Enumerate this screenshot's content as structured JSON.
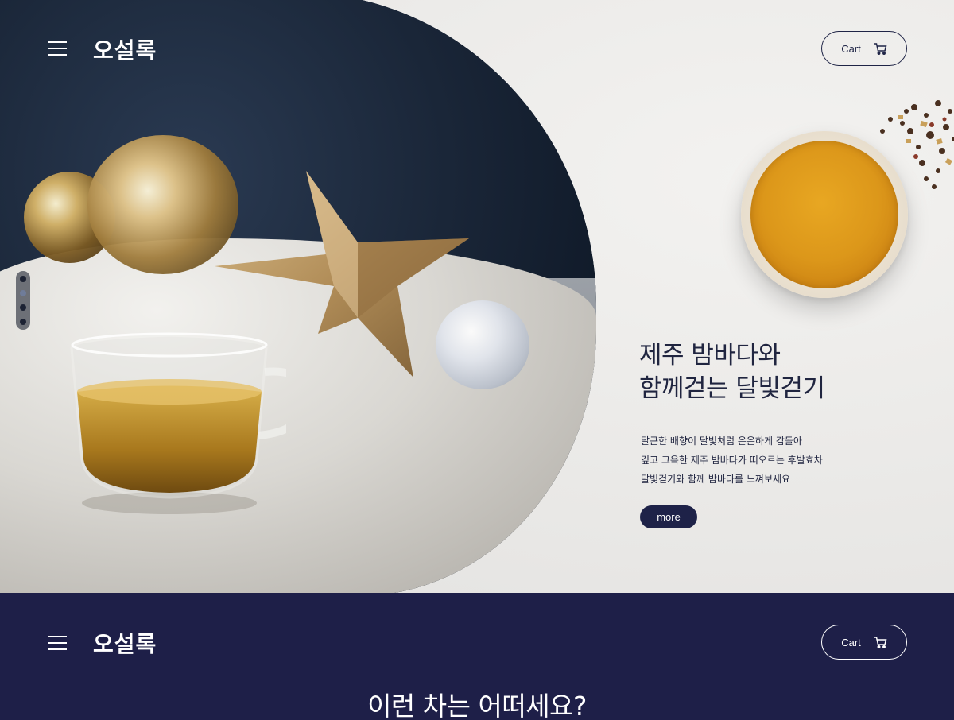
{
  "brand": {
    "logo": "오설록"
  },
  "header": {
    "cart_label": "Cart"
  },
  "hero": {
    "title_lines": [
      "제주 밤바다와",
      "함께걷는 달빛걷기"
    ],
    "desc_lines": [
      "달큰한 배향이 달빛처럼 은은하게 감돌아",
      "깊고 그윽한 제주 밤바다가 떠오르는 후발효차",
      "달빛걷기와 함께 밤바다를 느껴보세요"
    ],
    "more_label": "more",
    "pager": {
      "count": 4,
      "active_index": 1
    }
  },
  "section2": {
    "cart_label": "Cart",
    "title": "이런 차는 어떠세요?"
  },
  "colors": {
    "navy": "#1e1f48",
    "accent": "#1e2248",
    "tea": "#dc971a",
    "background": "#ecebe9"
  },
  "icons": [
    "menu-icon",
    "cart-icon"
  ]
}
